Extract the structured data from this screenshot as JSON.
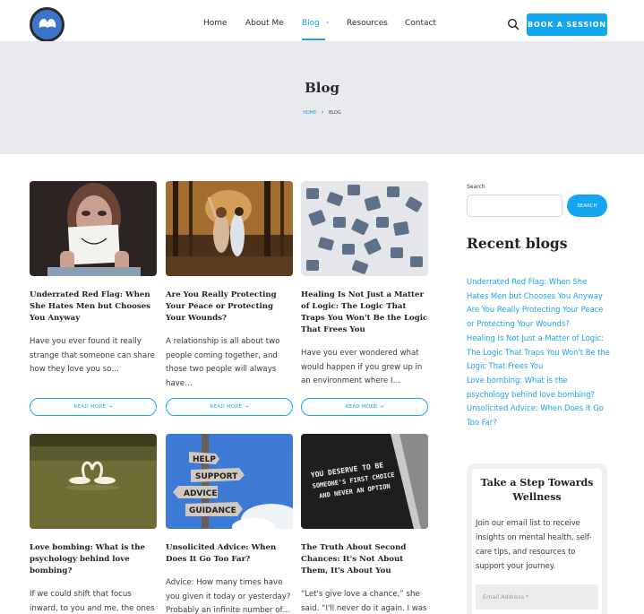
{
  "header": {
    "nav": [
      "Home",
      "About Me",
      "Blog",
      "Resources",
      "Contact"
    ],
    "blog_chevron": "⌄",
    "book_button": "BOOK A SESSION",
    "accent": "#14a7ef"
  },
  "banner": {
    "title": "Blog",
    "breadcrumb_home": "HOME",
    "breadcrumb_sep": "›",
    "breadcrumb_current": "BLOG"
  },
  "posts": [
    {
      "title": "Underrated Red Flag: When She Hates Men but Chooses You Anyway",
      "excerpt": "Have you ever found it really strange that someone can share how they love you so…",
      "read_more": "READ MORE →"
    },
    {
      "title": "Are You Really Protecting Your Peace or Protecting Your Wounds?",
      "excerpt": "A relationship is all about two people coming together, and those two people will always have…",
      "read_more": "READ MORE →"
    },
    {
      "title": "Healing Is Not Just a Matter of Logic: The Logic That Traps You Won't Be the Logic That Frees You",
      "excerpt": "Have you ever wondered what would happen if you grew up in an environment where I…",
      "read_more": "READ MORE →"
    },
    {
      "title": "Love bombing: What is the psychology behind love bombing?",
      "excerpt": "If we could shift that focus inward, to you and me, the ones"
    },
    {
      "title": "Unsolicited Advice: When Does It Go Too Far?",
      "excerpt": "Advice: How many times have you given it today or yesterday? Probably an infinite number of…"
    },
    {
      "title": "The Truth About Second Chances: It's Not About Them, It's About You",
      "excerpt": "“Let's give love a chance,” she said. “I'll never do it again. I was"
    }
  ],
  "images": {
    "paper_smile": "",
    "signpost": [
      "HELP",
      "SUPPORT",
      "ADVICE",
      "GUIDANCE"
    ],
    "chalk_quote": [
      "YOU DESERVE TO BE",
      "SOMEONE'S FIRST CHOICE",
      "AND NEVER AN OPTION"
    ]
  },
  "sidebar": {
    "search_label": "Search",
    "search_button": "SEARCH",
    "recent_heading": "Recent blogs",
    "recent": [
      "Underrated Red Flag: When She Hates Men but Chooses You Anyway",
      "Are You Really Protecting Your Peace or Protecting Your Wounds?",
      "Healing Is Not Just a Matter of Logic: The Logic That Traps You Won't Be the Logic That Frees You",
      "Love bombing: What is the psychology behind love bombing?",
      "Unsolicited Advice: When Does It Go Too Far?"
    ],
    "newsletter": {
      "title": "Take a Step Towards Wellness",
      "text": "Join our email list to receive insights on mental health, self-care tips, and resources to support your journey.",
      "email_placeholder": "Email Address *"
    }
  }
}
